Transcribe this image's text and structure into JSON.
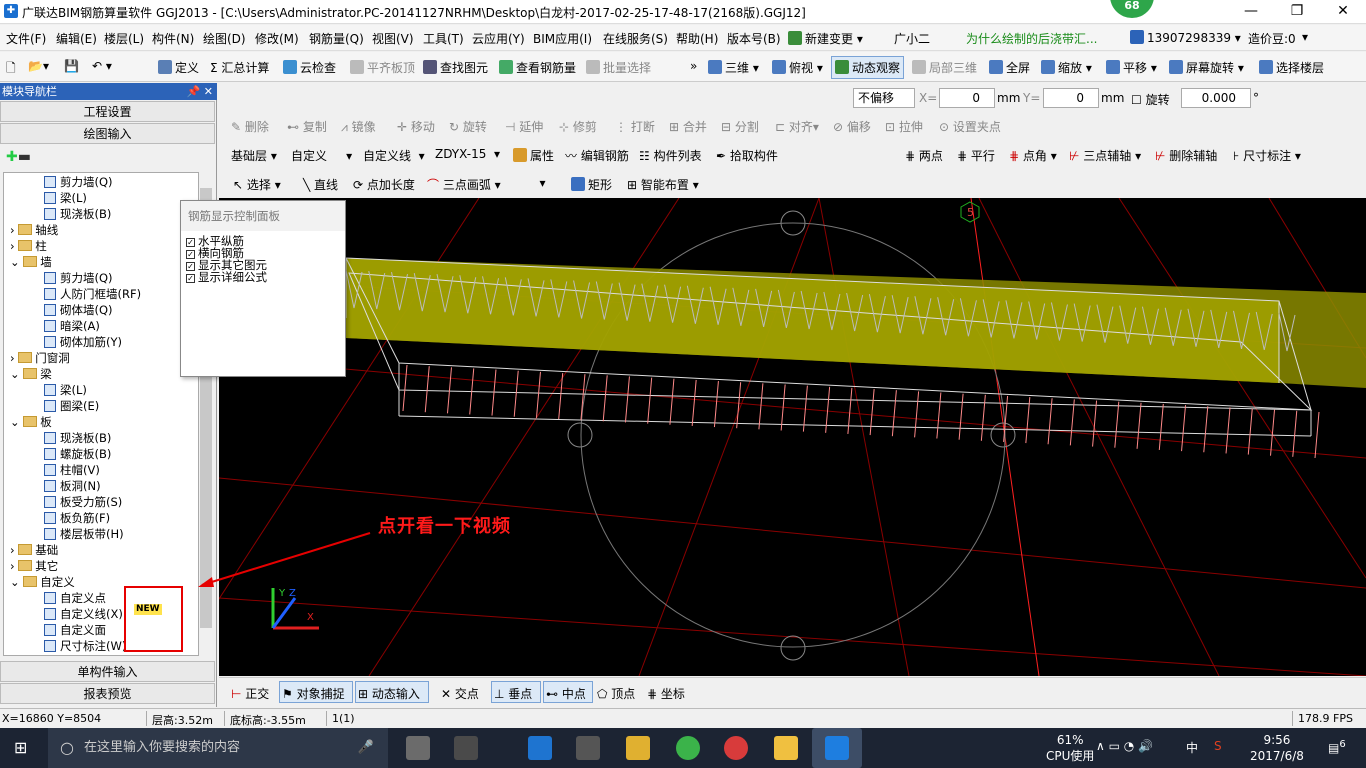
{
  "window": {
    "title": "广联达BIM钢筋算量软件 GGJ2013 - [C:\\Users\\Administrator.PC-20141127NRHM\\Desktop\\白龙村-2017-02-25-17-48-17(2168版).GGJ12]",
    "badge": "68",
    "minimize": "—",
    "maximize": "❐",
    "close": "✕"
  },
  "menu": {
    "items": [
      "文件(F)",
      "编辑(E)",
      "楼层(L)",
      "构件(N)",
      "绘图(D)",
      "修改(M)",
      "钢筋量(Q)",
      "视图(V)",
      "工具(T)",
      "云应用(Y)",
      "BIM应用(I)",
      "在线服务(S)",
      "帮助(H)",
      "版本号(B)"
    ],
    "new_change": "新建变更",
    "assistant": "广小二",
    "notice": "为什么绘制的后浇带汇...",
    "phone": "13907298339",
    "beans": "造价豆:0"
  },
  "toolbar1": {
    "items": [
      "定义",
      "汇总计算",
      "云检查",
      "平齐板顶",
      "查找图元",
      "查看钢筋量",
      "批量选择"
    ],
    "view_items": [
      "三维",
      "俯视",
      "动态观察",
      "局部三维",
      "全屏",
      "缩放",
      "平移",
      "屏幕旋转",
      "选择楼层"
    ]
  },
  "nav": {
    "header": "模块导航栏",
    "pin": "📌 ✕",
    "project_settings": "工程设置",
    "drawing_input": "绘图输入",
    "single_input": "单构件输入",
    "report_preview": "报表预览",
    "tree": [
      {
        "label": "剪力墙(Q)",
        "level": 2,
        "type": "leaf"
      },
      {
        "label": "梁(L)",
        "level": 2,
        "type": "leaf"
      },
      {
        "label": "现浇板(B)",
        "level": 2,
        "type": "leaf"
      },
      {
        "label": "轴线",
        "level": 1,
        "type": "folder",
        "state": "collapsed"
      },
      {
        "label": "柱",
        "level": 1,
        "type": "folder",
        "state": "collapsed"
      },
      {
        "label": "墙",
        "level": 1,
        "type": "folder",
        "state": "expanded"
      },
      {
        "label": "剪力墙(Q)",
        "level": 2,
        "type": "leaf"
      },
      {
        "label": "人防门框墙(RF)",
        "level": 2,
        "type": "leaf"
      },
      {
        "label": "砌体墙(Q)",
        "level": 2,
        "type": "leaf"
      },
      {
        "label": "暗梁(A)",
        "level": 2,
        "type": "leaf"
      },
      {
        "label": "砌体加筋(Y)",
        "level": 2,
        "type": "leaf"
      },
      {
        "label": "门窗洞",
        "level": 1,
        "type": "folder",
        "state": "collapsed"
      },
      {
        "label": "梁",
        "level": 1,
        "type": "folder",
        "state": "expanded"
      },
      {
        "label": "梁(L)",
        "level": 2,
        "type": "leaf"
      },
      {
        "label": "圈梁(E)",
        "level": 2,
        "type": "leaf"
      },
      {
        "label": "板",
        "level": 1,
        "type": "folder",
        "state": "expanded"
      },
      {
        "label": "现浇板(B)",
        "level": 2,
        "type": "leaf"
      },
      {
        "label": "螺旋板(B)",
        "level": 2,
        "type": "leaf"
      },
      {
        "label": "柱帽(V)",
        "level": 2,
        "type": "leaf"
      },
      {
        "label": "板洞(N)",
        "level": 2,
        "type": "leaf"
      },
      {
        "label": "板受力筋(S)",
        "level": 2,
        "type": "leaf"
      },
      {
        "label": "板负筋(F)",
        "level": 2,
        "type": "leaf"
      },
      {
        "label": "楼层板带(H)",
        "level": 2,
        "type": "leaf"
      },
      {
        "label": "基础",
        "level": 1,
        "type": "folder",
        "state": "collapsed"
      },
      {
        "label": "其它",
        "level": 1,
        "type": "folder",
        "state": "collapsed"
      },
      {
        "label": "自定义",
        "level": 1,
        "type": "folder",
        "state": "expanded"
      },
      {
        "label": "自定义点",
        "level": 2,
        "type": "leaf"
      },
      {
        "label": "自定义线(X)",
        "level": 2,
        "type": "leaf"
      },
      {
        "label": "自定义面",
        "level": 2,
        "type": "leaf"
      },
      {
        "label": "尺寸标注(W)",
        "level": 2,
        "type": "leaf"
      }
    ],
    "new_tag": "NEW"
  },
  "rebar_panel": {
    "title": "钢筋显示控制面板",
    "options": [
      {
        "label": "水平纵筋",
        "checked": true
      },
      {
        "label": "横向钢筋",
        "checked": true
      },
      {
        "label": "显示其它图元",
        "checked": true
      },
      {
        "label": "显示详细公式",
        "checked": true
      }
    ]
  },
  "offset_bar": {
    "offset_mode": "不偏移",
    "x_label": "X=",
    "x_value": "0",
    "unit1": "mm",
    "y_label": "Y=",
    "y_value": "0",
    "unit2": "mm",
    "rotate_label": "旋转",
    "rotate_value": "0.000",
    "degree": "°"
  },
  "edit_bar": {
    "items": [
      "删除",
      "复制",
      "镜像",
      "移动",
      "旋转",
      "延伸",
      "修剪",
      "打断",
      "合并",
      "分割",
      "对齐",
      "偏移",
      "拉伸",
      "设置夹点"
    ]
  },
  "layer_bar": {
    "floor": "基础层",
    "category": "自定义",
    "type": "自定义线",
    "component": "ZDYX-15",
    "items": [
      "属性",
      "编辑钢筋",
      "构件列表",
      "拾取构件"
    ],
    "axis_items": [
      "两点",
      "平行",
      "点角",
      "三点辅轴",
      "删除辅轴",
      "尺寸标注"
    ]
  },
  "draw_bar": {
    "items": [
      "选择",
      "直线",
      "点加长度",
      "三点画弧",
      "矩形",
      "智能布置"
    ]
  },
  "canvas": {
    "axis_label": "5",
    "annotation": "点开看一下视频",
    "axis_x": "X",
    "axis_y": "Y",
    "axis_z": "Z"
  },
  "snap_bar": {
    "items": [
      "正交",
      "对象捕捉",
      "动态输入",
      "交点",
      "垂点",
      "中点",
      "顶点",
      "坐标"
    ]
  },
  "status": {
    "coords": "X=16860 Y=8504",
    "floor_height": "层高:3.52m",
    "base_height": "底标高:-3.55m",
    "count": "1(1)",
    "fps": "178.9 FPS"
  },
  "taskbar": {
    "search_placeholder": "在这里输入你要搜索的内容",
    "cpu_percent": "61%",
    "cpu_label": "CPU使用",
    "ime": "中",
    "time": "9:56",
    "date": "2017/6/8",
    "notif_count": "6"
  },
  "colors": {
    "title_accent": "#2c63b8",
    "beam_fill": "#a8a800",
    "canvas_bg": "#000000",
    "annotation": "#ff1a1a"
  }
}
